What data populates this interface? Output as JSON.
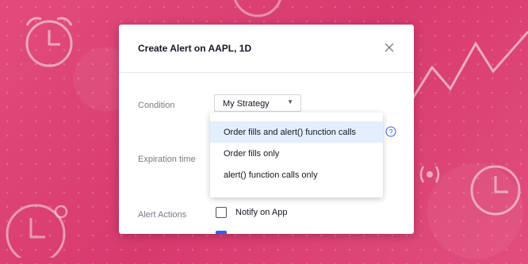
{
  "dialog": {
    "title": "Create Alert on AAPL, 1D",
    "condition_label": "Condition",
    "condition_value": "My Strategy",
    "expiration_label": "Expiration time",
    "actions_label": "Alert Actions",
    "notify_label": "Notify on App",
    "notify_checked": false
  },
  "dropdown": {
    "items": [
      {
        "label": "Order fills and alert() function calls",
        "selected": true
      },
      {
        "label": "Order fills only",
        "selected": false
      },
      {
        "label": "alert() function calls only",
        "selected": false
      }
    ]
  },
  "icons": {
    "close": "close-icon",
    "caret": "chevron-down-icon",
    "help": "question-circle-icon"
  },
  "colors": {
    "background": "#e8457a",
    "accent": "#2962ff",
    "selected_row": "#e3effd"
  }
}
